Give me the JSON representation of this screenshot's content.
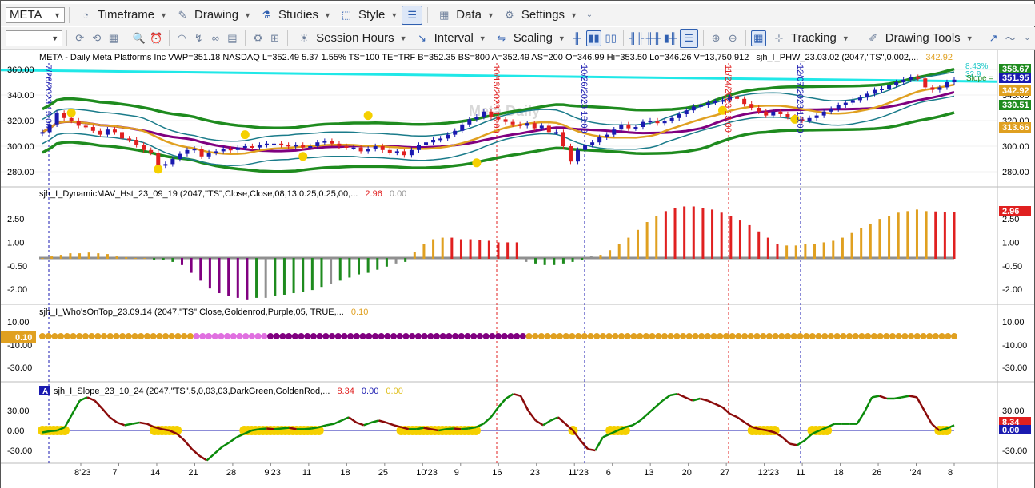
{
  "toolbar1": {
    "symbol": "META",
    "timeframe": "Timeframe",
    "drawing": "Drawing",
    "studies": "Studies",
    "style": "Style",
    "data": "Data",
    "settings": "Settings"
  },
  "toolbar2": {
    "session_hours": "Session Hours",
    "interval": "Interval",
    "scaling": "Scaling",
    "tracking": "Tracking",
    "drawing_tools": "Drawing Tools"
  },
  "price_pane": {
    "header_symbol": "META - Daily  Meta Platforms Inc  VWP=351.18  NASDAQ  L=352.49  5.37  1.55%  TS=100  TE=TRF  B=352.35  BS=800  A=352.49  AS=200  O=346.99  Hi=353.50  Lo=346.26  V=13,750,912",
    "header_study": "sjh_I_PHW_23.03.02 (2047,\"TS\",0.002,...",
    "header_val1": "342.92",
    "side_pct": "8.43%",
    "side_val": "32.9",
    "slope_label": "Slope =",
    "watermark": "Meta Daily",
    "date_labels": [
      "7/26/2023 13:00",
      "10/13/2023 13:00",
      "10/26/2023 13:00",
      "11/24/2023 13:00",
      "12/07/2023 13:00"
    ],
    "y_ticks": [
      "360.00",
      "340.00",
      "320.00",
      "300.00",
      "280.00"
    ],
    "price_tags": [
      {
        "value": "358.67",
        "color": "#1e8b1e"
      },
      {
        "value": "351.95",
        "color": "#1a1ab0"
      },
      {
        "value": "342.92",
        "color": "#e0a020"
      },
      {
        "value": "330.51",
        "color": "#1e8b1e"
      },
      {
        "value": "313.66",
        "color": "#e0a020"
      }
    ]
  },
  "hist_pane": {
    "title": "sjh_I_DynamicMAV_Hst_23_09_19 (2047,\"TS\",Close,Close,08,13,0.25,0.25,00,...",
    "v1": "2.96",
    "v2": "0.00",
    "y_ticks": [
      "2.50",
      "1.00",
      "-0.50",
      "-2.00"
    ],
    "tag": "2.96"
  },
  "dots_pane": {
    "title": "sjh_I_Who'sOnTop_23.09.14 (2047,\"TS\",Close,Goldenrod,Purple,05,  TRUE,...",
    "v1": "0.10",
    "y_ticks": [
      "10.00",
      "-10.00",
      "-30.00"
    ],
    "left_tag": "0.10"
  },
  "slope_pane": {
    "badge": "A",
    "title": "sjh_I_Slope_23_10_24 (2047,\"TS\",5,0,03,03,DarkGreen,GoldenRod,...",
    "v1": "8.34",
    "v2": "0.00",
    "v3": "0.00",
    "y_ticks": [
      "30.00",
      "0.00",
      "-30.00"
    ],
    "tags": [
      {
        "value": "8.34",
        "color": "#e02020"
      },
      {
        "value": "0.00",
        "color": "#1a1ab0"
      }
    ]
  },
  "x_axis": [
    "8'23",
    "7",
    "14",
    "21",
    "28",
    "9'23",
    "11",
    "18",
    "25",
    "10'23",
    "9",
    "16",
    "23",
    "11'23",
    "6",
    "13",
    "20",
    "27",
    "12'23",
    "11",
    "18",
    "26",
    "'24",
    "8"
  ],
  "colors": {
    "cyan": "#20e8e8",
    "band": "#1e8b1e",
    "teal": "#1a7b8a",
    "gold": "#e0a020",
    "purple": "#800080",
    "red": "#e02020",
    "blue": "#1a1ab0",
    "gray": "#909090",
    "pink": "#e070e0"
  },
  "chart_data": [
    {
      "type": "candlestick",
      "title": "META - Daily",
      "y_ticks": [
        360,
        340,
        320,
        300,
        280
      ],
      "closes": [
        311,
        317,
        326,
        322,
        320,
        316,
        315,
        312,
        309,
        313,
        311,
        306,
        305,
        301,
        297,
        295,
        285,
        286,
        290,
        294,
        297,
        298,
        292,
        295,
        296,
        298,
        297,
        299,
        300,
        299,
        301,
        302,
        302,
        301,
        300,
        301,
        299,
        300,
        303,
        304,
        302,
        300,
        299,
        299,
        296,
        298,
        300,
        297,
        295,
        296,
        293,
        297,
        301,
        303,
        305,
        306,
        309,
        312,
        317,
        321,
        323,
        327,
        323,
        321,
        319,
        317,
        316,
        318,
        314,
        316,
        311,
        311,
        300,
        288,
        297,
        301,
        303,
        307,
        309,
        313,
        317,
        314,
        315,
        319,
        320,
        318,
        320,
        322,
        325,
        328,
        331,
        332,
        334,
        335,
        336,
        339,
        337,
        333,
        330,
        327,
        324,
        327,
        325,
        323,
        321,
        320,
        322,
        324,
        327,
        329,
        332,
        334,
        336,
        338,
        341,
        344,
        345,
        348,
        350,
        352,
        354,
        353,
        346,
        344,
        346,
        350,
        352
      ]
    },
    {
      "type": "bar",
      "title": "sjh_I_DynamicMAV_Hst_23_09_19",
      "y_ticks": [
        2.5,
        1,
        -0.5,
        -2
      ],
      "values": [
        0,
        0.1,
        0.2,
        0.3,
        0.3,
        0.35,
        0.3,
        0.25,
        0.1,
        0.05,
        0,
        0,
        -0.05,
        -0.1,
        -0.2,
        -0.4,
        -0.9,
        -1.4,
        -1.9,
        -2.2,
        -2.4,
        -2.5,
        -2.6,
        -2.5,
        -2.5,
        -2.4,
        -2.3,
        -2.2,
        -2.1,
        -2.0,
        -1.8,
        -1.6,
        -1.4,
        -1.2,
        -1.0,
        -0.9,
        -0.7,
        -0.5,
        -0.3,
        -0.2,
        0.4,
        0.9,
        1.2,
        1.3,
        1.3,
        1.2,
        1.2,
        1.15,
        1.1,
        1.0,
        1.0,
        1.0,
        -0.2,
        -0.3,
        -0.4,
        -0.4,
        -0.3,
        -0.2,
        -0.1,
        0.1,
        0.2,
        0.5,
        0.9,
        1.3,
        1.8,
        2.3,
        2.7,
        3.0,
        3.2,
        3.3,
        3.3,
        3.2,
        3.1,
        2.9,
        2.7,
        2.4,
        2.1,
        1.7,
        1.3,
        0.9,
        0.8,
        0.8,
        0.9,
        0.9,
        1.0,
        1.1,
        1.3,
        1.6,
        1.9,
        2.2,
        2.5,
        2.7,
        2.9,
        3.0,
        3.1,
        3.0,
        2.98,
        2.96,
        2.96
      ]
    },
    {
      "type": "scatter",
      "title": "sjh_I_Who'sOnTop_23.09.14",
      "constant_value": 0.1,
      "y_ticks": [
        10,
        -10,
        -30
      ],
      "series": [
        {
          "name": "Goldenrod",
          "count": 25
        },
        {
          "name": "Pink",
          "count": 12
        },
        {
          "name": "Purple",
          "count": 42
        },
        {
          "name": "Goldenrod",
          "count": 70
        }
      ]
    },
    {
      "type": "line",
      "title": "sjh_I_Slope_23_10_24",
      "y_ticks": [
        30,
        0,
        -30
      ],
      "values": [
        -3,
        -1,
        0,
        5,
        25,
        45,
        50,
        45,
        33,
        20,
        12,
        8,
        10,
        12,
        10,
        5,
        2,
        0,
        -5,
        -15,
        -28,
        -38,
        -45,
        -35,
        -25,
        -18,
        -10,
        -5,
        0,
        2,
        3,
        2,
        3,
        4,
        2,
        2,
        3,
        5,
        8,
        10,
        15,
        20,
        12,
        8,
        12,
        15,
        12,
        8,
        5,
        2,
        2,
        4,
        2,
        0,
        2,
        3,
        2,
        3,
        5,
        10,
        20,
        35,
        48,
        55,
        52,
        30,
        15,
        8,
        15,
        20,
        10,
        0,
        -15,
        -28,
        -30,
        -10,
        -5,
        0,
        5,
        8,
        15,
        25,
        35,
        45,
        53,
        55,
        50,
        45,
        48,
        45,
        40,
        35,
        25,
        20,
        12,
        5,
        2,
        0,
        -3,
        -10,
        -20,
        -22,
        -15,
        -5,
        0,
        5,
        10,
        10,
        10,
        10,
        28,
        50,
        52,
        48,
        48,
        50,
        52,
        50,
        30,
        10,
        0,
        3,
        8
      ]
    }
  ]
}
